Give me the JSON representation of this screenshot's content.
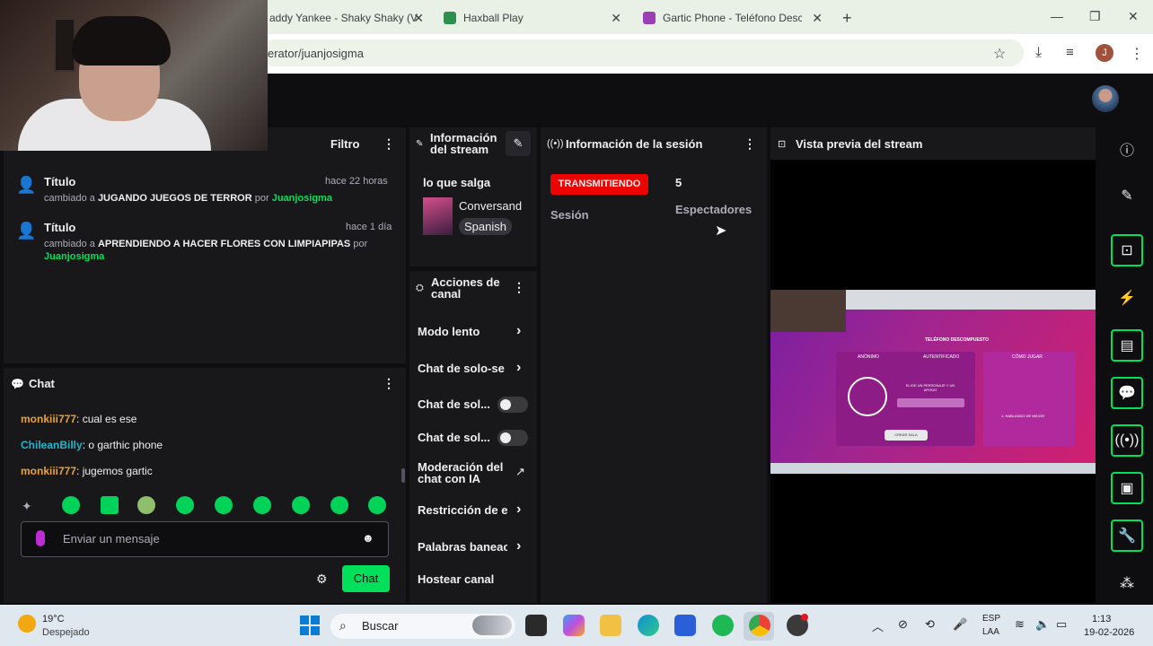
{
  "browser": {
    "tabs": [
      {
        "title": "addy Yankee - Shaky Shaky (V"
      },
      {
        "title": "Haxball Play"
      },
      {
        "title": "Gartic Phone - Teléfono Descor"
      }
    ],
    "new_tab": "+",
    "url": "erator/juanjosigma",
    "profile_initial": "J"
  },
  "activity": {
    "filter_label": "Filtro",
    "items": [
      {
        "title": "Título",
        "time": "hace 22 horas",
        "prefix": "cambiado a",
        "value": "JUGANDO JUEGOS DE TERROR",
        "by": "por",
        "user": "Juanjosigma"
      },
      {
        "title": "Título",
        "time": "hace 1 día",
        "prefix": "cambiado a",
        "value": "APRENDIENDO A HACER FLORES CON LIMPIAPIPAS",
        "by": "por",
        "user": "Juanjosigma"
      }
    ]
  },
  "chat": {
    "title": "Chat",
    "messages": [
      {
        "user": "monkiii777",
        "text": "cual es ese",
        "color": "#e6a23c"
      },
      {
        "user": "ChileanBilly",
        "text": "o garthic phone",
        "color": "#1fb5c9"
      },
      {
        "user": "monkiii777",
        "text": "jugemos gartic",
        "color": "#e6a23c"
      }
    ],
    "placeholder": "Enviar un mensaje",
    "send_label": "Chat"
  },
  "stream_info": {
    "title": "Información del stream",
    "stream_title": "lo que salga",
    "category": "Conversand",
    "language": "Spanish"
  },
  "channel_actions": {
    "title": "Acciones de canal",
    "items": [
      {
        "label": "Modo lento"
      },
      {
        "label": "Chat de solo-se"
      },
      {
        "label": "Chat de sol..."
      },
      {
        "label": "Chat de sol..."
      },
      {
        "label": "Moderación del chat con IA"
      },
      {
        "label": "Restricción de e"
      },
      {
        "label": "Palabras baneac"
      },
      {
        "label": "Hostear canal"
      }
    ]
  },
  "session": {
    "title": "Información de la sesión",
    "status_badge": "TRANSMITIENDO",
    "session_label": "Sesión",
    "viewers": "5",
    "viewers_label": "Espectadores",
    "status_color": "#eb0400"
  },
  "preview": {
    "title": "Vista previa del stream",
    "preview_heading": "TELÉFONO DESCOMPUESTO",
    "tabs": [
      "ANÓNIMO",
      "AUTENTIFICADO",
      "CÓMO JUGAR"
    ],
    "prompt": "ELIGE UN PERSONAJE Y UN APODO",
    "create_btn": "CREAR SALA",
    "howto": "1. HABLANDO DE MEJOR"
  },
  "taskbar": {
    "weather_temp": "19°C",
    "weather_desc": "Despejado",
    "search_placeholder": "Buscar",
    "lang_top": "ESP",
    "lang_bottom": "LAA",
    "time": "1:13",
    "date": "19-02-2026"
  },
  "colors": {
    "accent": "#00e05a",
    "panel": "#18181b",
    "background": "#0e0e10"
  }
}
